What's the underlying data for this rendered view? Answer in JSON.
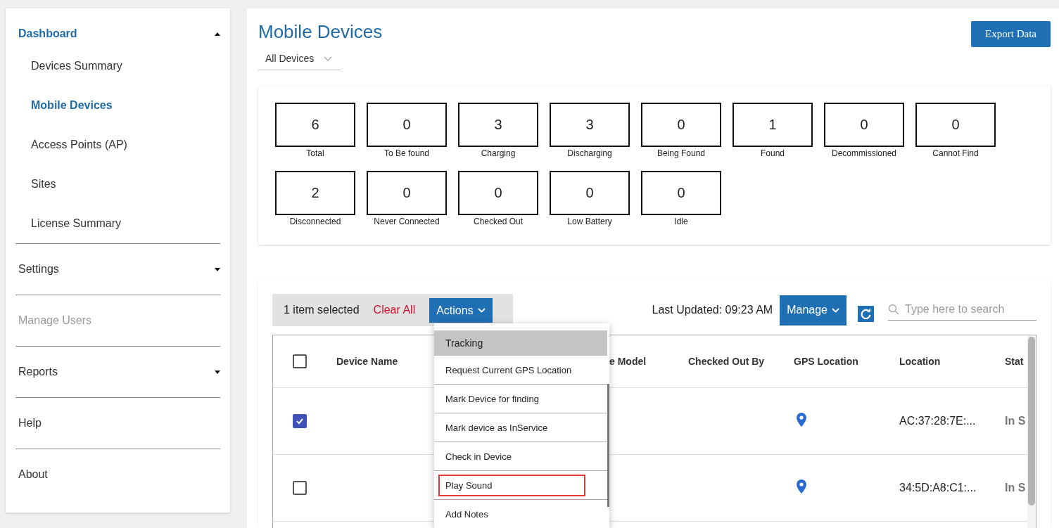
{
  "sidebar": {
    "sections": [
      {
        "label": "Dashboard",
        "kind": "group",
        "expanded": true,
        "active": true,
        "disabled": false,
        "children": [
          {
            "label": "Devices Summary",
            "selected": false
          },
          {
            "label": "Mobile Devices",
            "selected": true
          },
          {
            "label": "Access Points (AP)",
            "selected": false
          },
          {
            "label": "Sites",
            "selected": false
          },
          {
            "label": "License Summary",
            "selected": false
          }
        ]
      },
      {
        "label": "Settings",
        "kind": "group",
        "expanded": false,
        "active": false,
        "disabled": false
      },
      {
        "label": "Manage Users",
        "kind": "link",
        "active": false,
        "disabled": true
      },
      {
        "label": "Reports",
        "kind": "group",
        "expanded": false,
        "active": false,
        "disabled": false
      },
      {
        "label": "Help",
        "kind": "link",
        "active": false,
        "disabled": false
      },
      {
        "label": "About",
        "kind": "link",
        "active": false,
        "disabled": false
      }
    ]
  },
  "page": {
    "title": "Mobile Devices",
    "filter": "All Devices",
    "export_button": "Export Data"
  },
  "stats": [
    {
      "value": "6",
      "label": "Total"
    },
    {
      "value": "0",
      "label": "To Be found"
    },
    {
      "value": "3",
      "label": "Charging"
    },
    {
      "value": "3",
      "label": "Discharging"
    },
    {
      "value": "0",
      "label": "Being Found"
    },
    {
      "value": "1",
      "label": "Found"
    },
    {
      "value": "0",
      "label": "Decommissioned"
    },
    {
      "value": "0",
      "label": "Cannot Find"
    },
    {
      "value": "2",
      "label": "Disconnected"
    },
    {
      "value": "0",
      "label": "Never Connected"
    },
    {
      "value": "0",
      "label": "Checked Out"
    },
    {
      "value": "0",
      "label": "Low Battery"
    },
    {
      "value": "0",
      "label": "Idle"
    }
  ],
  "toolbar": {
    "selection": "1 item selected",
    "clear": "Clear All",
    "actions": "Actions",
    "last_updated": "Last Updated: 09:23 AM",
    "manage": "Manage",
    "search": {
      "placeholder": "Type here to search"
    }
  },
  "actions_menu": [
    {
      "label": "Tracking",
      "kind": "header",
      "outlined": false
    },
    {
      "label": "Request Current GPS Location",
      "kind": "item",
      "outlined": false
    },
    {
      "label": "Mark Device for finding",
      "kind": "item",
      "outlined": false
    },
    {
      "label": "Mark device as InService",
      "kind": "item",
      "outlined": false
    },
    {
      "label": "Check in Device",
      "kind": "item",
      "outlined": false
    },
    {
      "label": "Play Sound",
      "kind": "item",
      "outlined": true
    },
    {
      "label": "Add Notes",
      "kind": "item",
      "outlined": false
    }
  ],
  "table": {
    "header_checked": false,
    "columns": [
      "Device Name",
      "e Model",
      "Checked Out By",
      "GPS Location",
      "Location",
      "Stat"
    ],
    "rows": [
      {
        "checked": true,
        "gps": true,
        "location": "AC:37:28:7E:...",
        "status": "In S"
      },
      {
        "checked": false,
        "gps": true,
        "location": "34:5D:A8:C1:...",
        "status": "In S"
      }
    ]
  }
}
